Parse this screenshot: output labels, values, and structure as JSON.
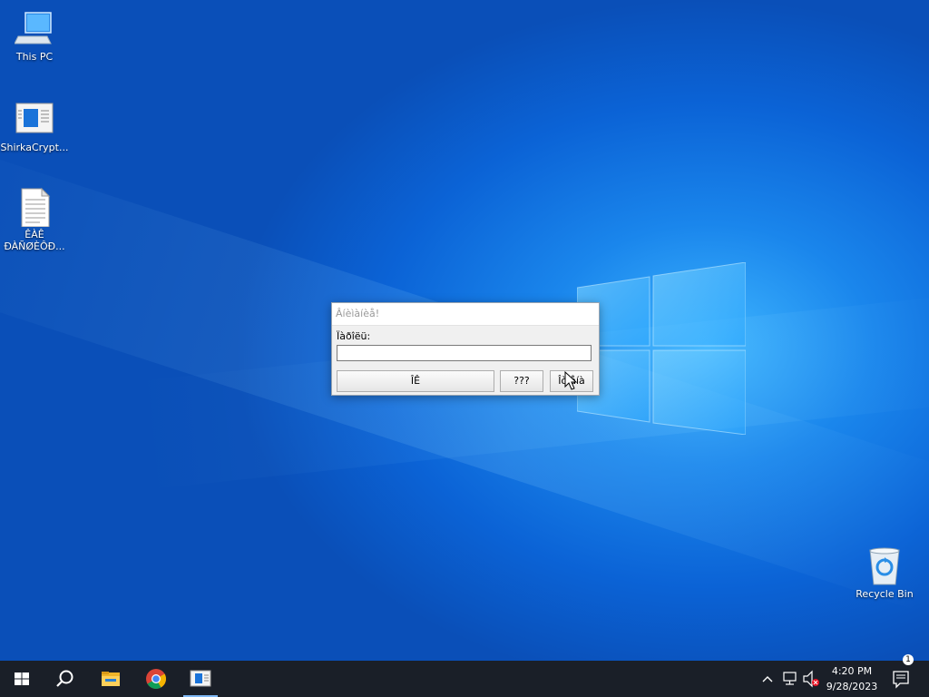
{
  "desktop": {
    "icons": [
      {
        "label": "This PC",
        "icon": "computer-icon"
      },
      {
        "label": "ShirkaCrypt...",
        "icon": "app-window-icon"
      },
      {
        "label": "ÊÀÊ\nÐÀÑØÈÔÐ...",
        "icon": "text-document-icon"
      },
      {
        "label": "Recycle Bin",
        "icon": "recycle-bin-icon"
      }
    ]
  },
  "dialog": {
    "title": "Âíèìàíèå!",
    "prompt_label": "Ïàðîëü:",
    "input_value": "",
    "ok_label": "ÎÊ",
    "help_label": "???",
    "cancel_label": "Îòìåíà"
  },
  "taskbar": {
    "items": [
      {
        "icon": "windows-start-icon"
      },
      {
        "icon": "search-icon"
      },
      {
        "icon": "file-explorer-icon"
      },
      {
        "icon": "chrome-icon"
      },
      {
        "icon": "app-window-icon",
        "active": true
      }
    ],
    "tray": {
      "icons": [
        "chevron-up-icon",
        "network-icon",
        "volume-muted-icon"
      ],
      "time": "4:20 PM",
      "date": "9/28/2023",
      "notification_count": "1"
    }
  },
  "colors": {
    "accent": "#0b63d6",
    "taskbar": "#1a1f28"
  }
}
